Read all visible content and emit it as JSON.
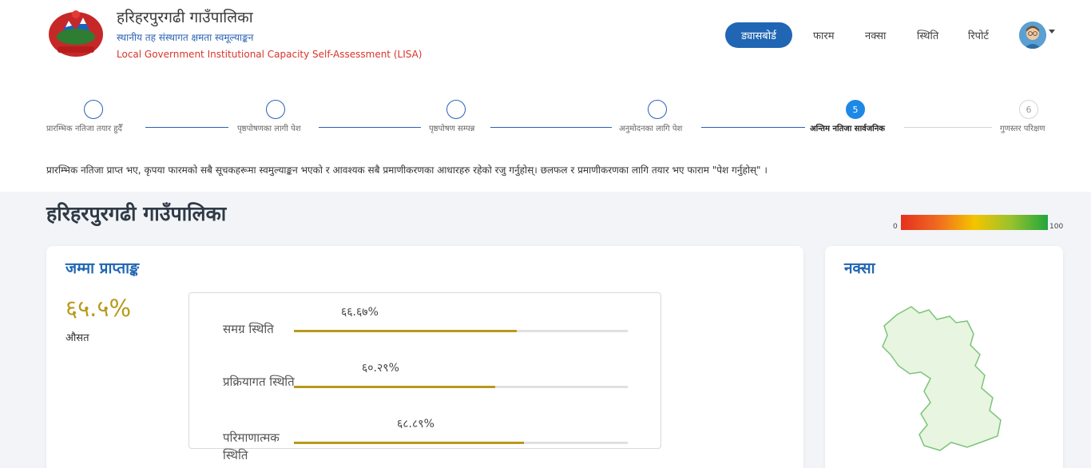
{
  "header": {
    "org_name": "हरिहरपुरगढी गाउँपालिका",
    "subtitle_np": "स्थानीय तह संस्थागत क्षमता स्वमूल्याङ्कन",
    "subtitle_en": "Local Government Institutional Capacity Self-Assessment (LISA)",
    "emblem_icon": "nepal-emblem-icon",
    "nav": [
      {
        "label": "ड्यासबोर्ड",
        "active": true
      },
      {
        "label": "फारम",
        "active": false
      },
      {
        "label": "नक्सा",
        "active": false
      },
      {
        "label": "स्थिति",
        "active": false
      },
      {
        "label": "रिपोर्ट",
        "active": false
      }
    ],
    "avatar_icon": "user-avatar-icon"
  },
  "stepper": {
    "steps": [
      {
        "label": "प्रारम्भिक नतिजा तयार हुदैँ",
        "number": "",
        "state": "done"
      },
      {
        "label": "पृष्ठपोषणका लागी पेश",
        "number": "",
        "state": "done"
      },
      {
        "label": "पृष्ठपोषण सम्पन्न",
        "number": "",
        "state": "done"
      },
      {
        "label": "अनुमोदनका लागि पेश",
        "number": "",
        "state": "done"
      },
      {
        "label": "अन्तिम नतिजा सार्वजनिक",
        "number": "5",
        "state": "active"
      },
      {
        "label": "गुणस्तर परिक्षण",
        "number": "6",
        "state": "pending"
      }
    ]
  },
  "notice": "प्रारम्भिक नतिजा प्राप्त भए, कृपया फारमको सबै सूचकहरूमा स्वमुल्याङ्कन भएको र आवश्यक सबै प्रमाणीकरणका आधारहरु रहेको रजु गर्नुहोस्। छलफल र प्रमाणीकरणका लागि तयार भए फाराम \"पेश गर्नुहोस्\" ।",
  "page_title": "हरिहरपुरगढी गाउँपालिका",
  "score_scale": {
    "min": "0",
    "max": "100"
  },
  "total_card": {
    "title": "जम्मा प्राप्ताङ्क",
    "value": "६५.५%",
    "caption": "औसत",
    "bars": [
      {
        "label": "समग्र स्थिति",
        "value_text": "६६.६७%",
        "percent": 66.67
      },
      {
        "label": "प्रक्रियागत स्थिति",
        "value_text": "६०.२९%",
        "percent": 60.29
      },
      {
        "label": "परिमाणात्मक स्थिति",
        "value_text": "६८.८९%",
        "percent": 68.89
      }
    ]
  },
  "map_card": {
    "title": "नक्सा",
    "map_icon": "municipality-map-outline"
  }
}
